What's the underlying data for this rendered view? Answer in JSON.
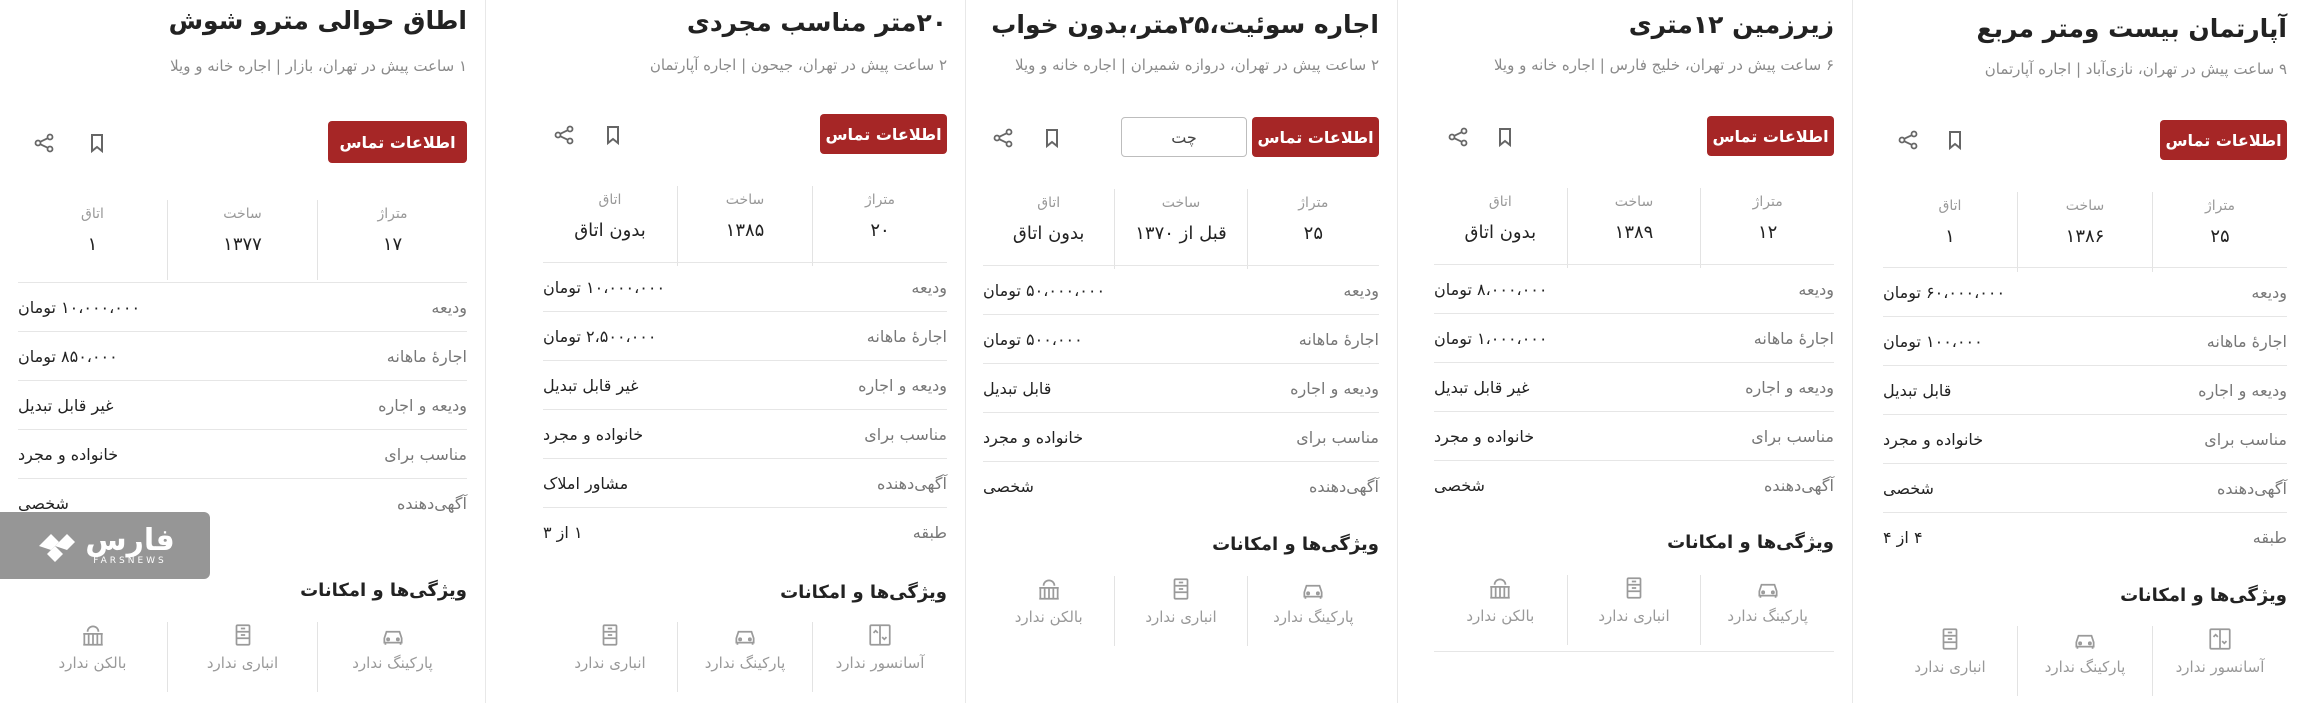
{
  "colors": {
    "accent": "#a62626",
    "muted": "#8a8a8a",
    "divider": "#e6e6e6"
  },
  "labels": {
    "area": "متراژ",
    "built": "ساخت",
    "rooms": "اتاق",
    "deposit": "ودیعه",
    "monthly_rent": "اجارهٔ ماهانه",
    "deposit_rent": "ودیعه و اجاره",
    "suitable_for": "مناسب برای",
    "advertiser": "آگهی‌دهنده",
    "floor": "طبقه",
    "features_title": "ویژگی‌ها و امکانات",
    "contact": "اطلاعات تماس",
    "chat": "چت"
  },
  "listings": [
    {
      "title": "اطاق حوالی مترو شوش",
      "subtitle": "۱ ساعت پیش در تهران، بازار | اجاره خانه و ویلا",
      "area": "۱۷",
      "built": "۱۳۷۷",
      "rooms": "۱",
      "deposit": "۱۰،۰۰۰،۰۰۰ تومان",
      "monthly_rent": "۸۵۰،۰۰۰ تومان",
      "deposit_rent": "غیر قابل تبدیل",
      "suitable_for": "خانواده و مجرد",
      "advertiser": "شخصی",
      "features": [
        {
          "label": "پارکینگ ندارد",
          "icon": "car-icon"
        },
        {
          "label": "انباری ندارد",
          "icon": "storage-icon"
        },
        {
          "label": "بالکن ندارد",
          "icon": "balcony-icon"
        }
      ]
    },
    {
      "title": "۲۰متر مناسب مجردی",
      "subtitle": "۲ ساعت پیش در تهران، جیحون | اجاره آپارتمان",
      "area": "۲۰",
      "built": "۱۳۸۵",
      "rooms": "بدون اتاق",
      "deposit": "۱۰،۰۰۰،۰۰۰ تومان",
      "monthly_rent": "۲،۵۰۰،۰۰۰ تومان",
      "deposit_rent": "غیر قابل تبدیل",
      "suitable_for": "خانواده و مجرد",
      "advertiser": "مشاور املاک",
      "floor": "۱ از ۳",
      "features": [
        {
          "label": "آسانسور ندارد",
          "icon": "elevator-icon"
        },
        {
          "label": "پارکینگ ندارد",
          "icon": "car-icon"
        },
        {
          "label": "انباری ندارد",
          "icon": "storage-icon"
        }
      ]
    },
    {
      "title": "اجاره سوئیت،۲۵متر،بدون خواب",
      "subtitle": "۲ ساعت پیش در تهران، دروازه شمیران | اجاره خانه و ویلا",
      "area": "۲۵",
      "built": "قبل از ۱۳۷۰",
      "rooms": "بدون اتاق",
      "deposit": "۵۰،۰۰۰،۰۰۰ تومان",
      "monthly_rent": "۵۰۰،۰۰۰ تومان",
      "deposit_rent": "قابل تبدیل",
      "suitable_for": "خانواده و مجرد",
      "advertiser": "شخصی",
      "features": [
        {
          "label": "پارکینگ ندارد",
          "icon": "car-icon"
        },
        {
          "label": "انباری ندارد",
          "icon": "storage-icon"
        },
        {
          "label": "بالکن ندارد",
          "icon": "balcony-icon"
        }
      ]
    },
    {
      "title": "زیرزمین ۱۲متری",
      "subtitle": "۶ ساعت پیش در تهران، خلیج فارس | اجاره خانه و ویلا",
      "area": "۱۲",
      "built": "۱۳۸۹",
      "rooms": "بدون اتاق",
      "deposit": "۸،۰۰۰،۰۰۰ تومان",
      "monthly_rent": "۱،۰۰۰،۰۰۰ تومان",
      "deposit_rent": "غیر قابل تبدیل",
      "suitable_for": "خانواده و مجرد",
      "advertiser": "شخصی",
      "features": [
        {
          "label": "پارکینگ ندارد",
          "icon": "car-icon"
        },
        {
          "label": "انباری ندارد",
          "icon": "storage-icon"
        },
        {
          "label": "بالکن ندارد",
          "icon": "balcony-icon"
        }
      ]
    },
    {
      "title": "آپارتمان بیست ومتر مربع",
      "subtitle": "۹ ساعت پیش در تهران، نازی‌آباد | اجاره آپارتمان",
      "area": "۲۵",
      "built": "۱۳۸۶",
      "rooms": "۱",
      "deposit": "۶۰،۰۰۰،۰۰۰ تومان",
      "monthly_rent": "۱۰۰،۰۰۰ تومان",
      "deposit_rent": "قابل تبدیل",
      "suitable_for": "خانواده و مجرد",
      "advertiser": "شخصی",
      "floor": "۴ از ۴",
      "features": [
        {
          "label": "آسانسور ندارد",
          "icon": "elevator-icon"
        },
        {
          "label": "پارکینگ ندارد",
          "icon": "car-icon"
        },
        {
          "label": "انباری ندارد",
          "icon": "storage-icon"
        }
      ]
    }
  ],
  "watermark": {
    "brand": "فارس",
    "latin": "FARSNEWS"
  }
}
